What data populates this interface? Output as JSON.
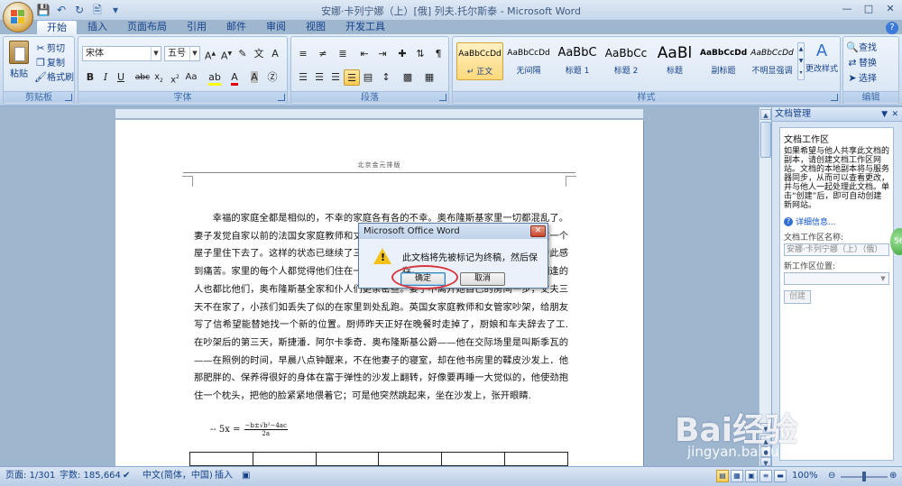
{
  "window": {
    "title": "安娜·卡列宁娜（上）[俄] 列夫.托尔斯泰 - Microsoft Word"
  },
  "tabs": [
    "开始",
    "插入",
    "页面布局",
    "引用",
    "邮件",
    "审阅",
    "视图",
    "开发工具"
  ],
  "ribbon": {
    "clipboard": {
      "label": "剪贴板",
      "paste": "粘贴",
      "cut": "剪切",
      "copy": "复制",
      "format_painter": "格式刷"
    },
    "font": {
      "label": "字体",
      "font_name": "宋体",
      "font_size": "五号"
    },
    "paragraph": {
      "label": "段落"
    },
    "styles": {
      "label": "样式",
      "items": [
        {
          "preview": "AaBbCcDd",
          "name": "↵ 正文"
        },
        {
          "preview": "AaBbCcDd",
          "name": "无间隔"
        },
        {
          "preview": "AaBbC",
          "name": "标题 1"
        },
        {
          "preview": "AaBbCc",
          "name": "标题 2"
        },
        {
          "preview": "AaBl",
          "name": "标题"
        },
        {
          "preview": "AaBbCcDd",
          "name": "副标题"
        },
        {
          "preview": "AaBbCcDd",
          "name": "不明显强调"
        }
      ],
      "change_styles": "更改样式"
    },
    "editing": {
      "label": "编辑",
      "find": "查找",
      "replace": "替换",
      "select": "选择"
    }
  },
  "document": {
    "header": "北京金元排版",
    "body": "幸福的家庭全都是相似的，不幸的家庭各有各的不幸。奥布隆斯基家里一切都混乱了。妻子发觉自家以前的法国女家庭教师和丈夫有暧昧关系，就向丈夫声明不能再和他住在一个屋子里住下去了。这样的状态已继续了三天，不仅使这对夫妇本人，就是全家的人都为此感到痛苦。家里的每个人都觉得他们住在一起没有意思，就是偶然在客店里碰到的萍水相逢的人也都比他们，奥布隆斯基全家和仆人们更亲密些。妻子不离开她自己的房间一步，丈夫三天不在家了，小孩们如丢失了似的在家里到处乱跑。英国女家庭教师和女管家吵架，给朋友写了信希望能替她找一个新的位置。厨师昨天正好在晚餐时走掉了，厨娘和车夫辞去了工.在吵架后的第三天，斯捷潘．阿尔卡季奇．奥布隆斯基公爵——他在交际场里是叫斯季瓦的——在照例的时间，早晨八点钟醒来，不在他妻子的寝室，却在他书房里的鞣皮沙发上．他那肥胖的、保养得很好的身体在富于弹性的沙发上翻转，好像要再睡一大觉似的，他使劲抱住一个枕头，把他的脸紧紧地偎着它；可是他突然跳起来，坐在沙发上，张开眼睛.",
    "formula_lhs": "-- 5x =",
    "formula_num": "−b±√b²−4ac",
    "formula_den": "2a"
  },
  "task_pane": {
    "title": "文档管理",
    "section": "文档工作区",
    "description": "如果希望与他人共享此文档的副本，请创建文档工作区网站。文档的本地副本将与服务器同步，从而可以查看更改，并与他人一起处理此文档。单击“创建”后，即可自动创建新网站。",
    "more_info": "详细信息...",
    "name_label": "文档工作区名称:",
    "name_value": "安娜·卡列宁娜（上）（俄）",
    "location_label": "新工作区位置:",
    "create_button": "创建"
  },
  "dialog": {
    "title": "Microsoft Office Word",
    "message": "此文档将先被标记为终稿，然后保存。",
    "ok": "确定",
    "cancel": "取消"
  },
  "status": {
    "page": "页面: 1/301",
    "words": "字数: 185,664",
    "language": "中文(简体，中国)",
    "insert": "插入",
    "zoom": "100%"
  },
  "watermark": {
    "main": "Bai经验",
    "sub": "jingyan.baidu.com"
  },
  "colors": {
    "ribbon_bg": "#d7e4f3",
    "accent": "#15428b",
    "highlight": "#ffd87a",
    "annotation_ring": "#d8373f"
  }
}
